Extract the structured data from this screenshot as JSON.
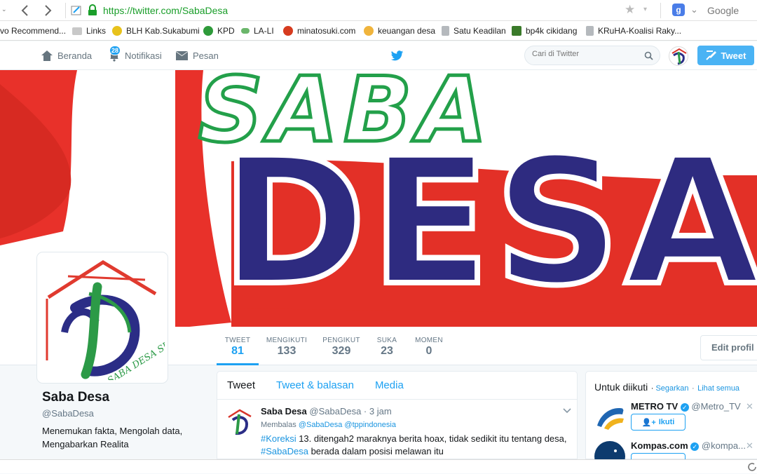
{
  "browser": {
    "url": "https://twitter.com/SabaDesa",
    "search_engine": "Google"
  },
  "bookmarks": [
    {
      "label": "vo Recommend...",
      "color": "#ffffff"
    },
    {
      "label": "Links",
      "color": "#c8a85a"
    },
    {
      "label": "BLH Kab.Sukabumi",
      "color": "#e8c21c"
    },
    {
      "label": "KPD",
      "color": "#2e9a3a"
    },
    {
      "label": "LA-LI",
      "color": "#6bb66b"
    },
    {
      "label": "minatosuki.com",
      "color": "#d63b1f"
    },
    {
      "label": "keuangan desa",
      "color": "#f0b43c"
    },
    {
      "label": "Satu Keadilan",
      "color": "#9aa0a6"
    },
    {
      "label": "bp4k cikidang",
      "color": "#3a7a2a"
    },
    {
      "label": "KRuHA-Koalisi Raky...",
      "color": "#9aa0a6"
    }
  ],
  "twitter_nav": {
    "home": "Beranda",
    "notifications": "Notifikasi",
    "notif_count": "28",
    "messages": "Pesan",
    "search_placeholder": "Cari di Twitter",
    "tweet_button": "Tweet"
  },
  "banner": {
    "line1": "SABA",
    "line2": "DESA"
  },
  "stats": [
    {
      "label": "TWEET",
      "value": "81"
    },
    {
      "label": "MENGIKUTI",
      "value": "133"
    },
    {
      "label": "PENGIKUT",
      "value": "329"
    },
    {
      "label": "SUKA",
      "value": "23"
    },
    {
      "label": "MOMEN",
      "value": "0"
    }
  ],
  "edit_profile": "Edit profil",
  "profile": {
    "name": "Saba Desa",
    "handle": "@SabaDesa",
    "bio": "Menemukan fakta, Mengolah data, Mengabarkan Realita",
    "avatar_text": "SABA DESA SUKABUMI"
  },
  "timeline_tabs": [
    "Tweet",
    "Tweet & balasan",
    "Media"
  ],
  "tweet": {
    "name": "Saba Desa",
    "handle": "@SabaDesa",
    "time": "3 jam",
    "reply_prefix": "Membalas",
    "reply_to": "@SabaDesa @tppindonesia",
    "hashtag1": "#Koreksi",
    "text1": " 13. ditengah2 maraknya berita hoax, tidak sedikit itu tentang desa,",
    "hashtag2": "#SabaDesa",
    "text2": " berada dalam posisi melawan itu"
  },
  "who_to_follow": {
    "title": "Untuk diikuti",
    "refresh": "Segarkan",
    "separator": "·",
    "view_all": "Lihat semua",
    "follow_label": "Ikuti",
    "accounts": [
      {
        "name": "METRO TV",
        "handle": "@Metro_TV"
      },
      {
        "name": "Kompas.com",
        "handle": "@kompa..."
      }
    ]
  }
}
